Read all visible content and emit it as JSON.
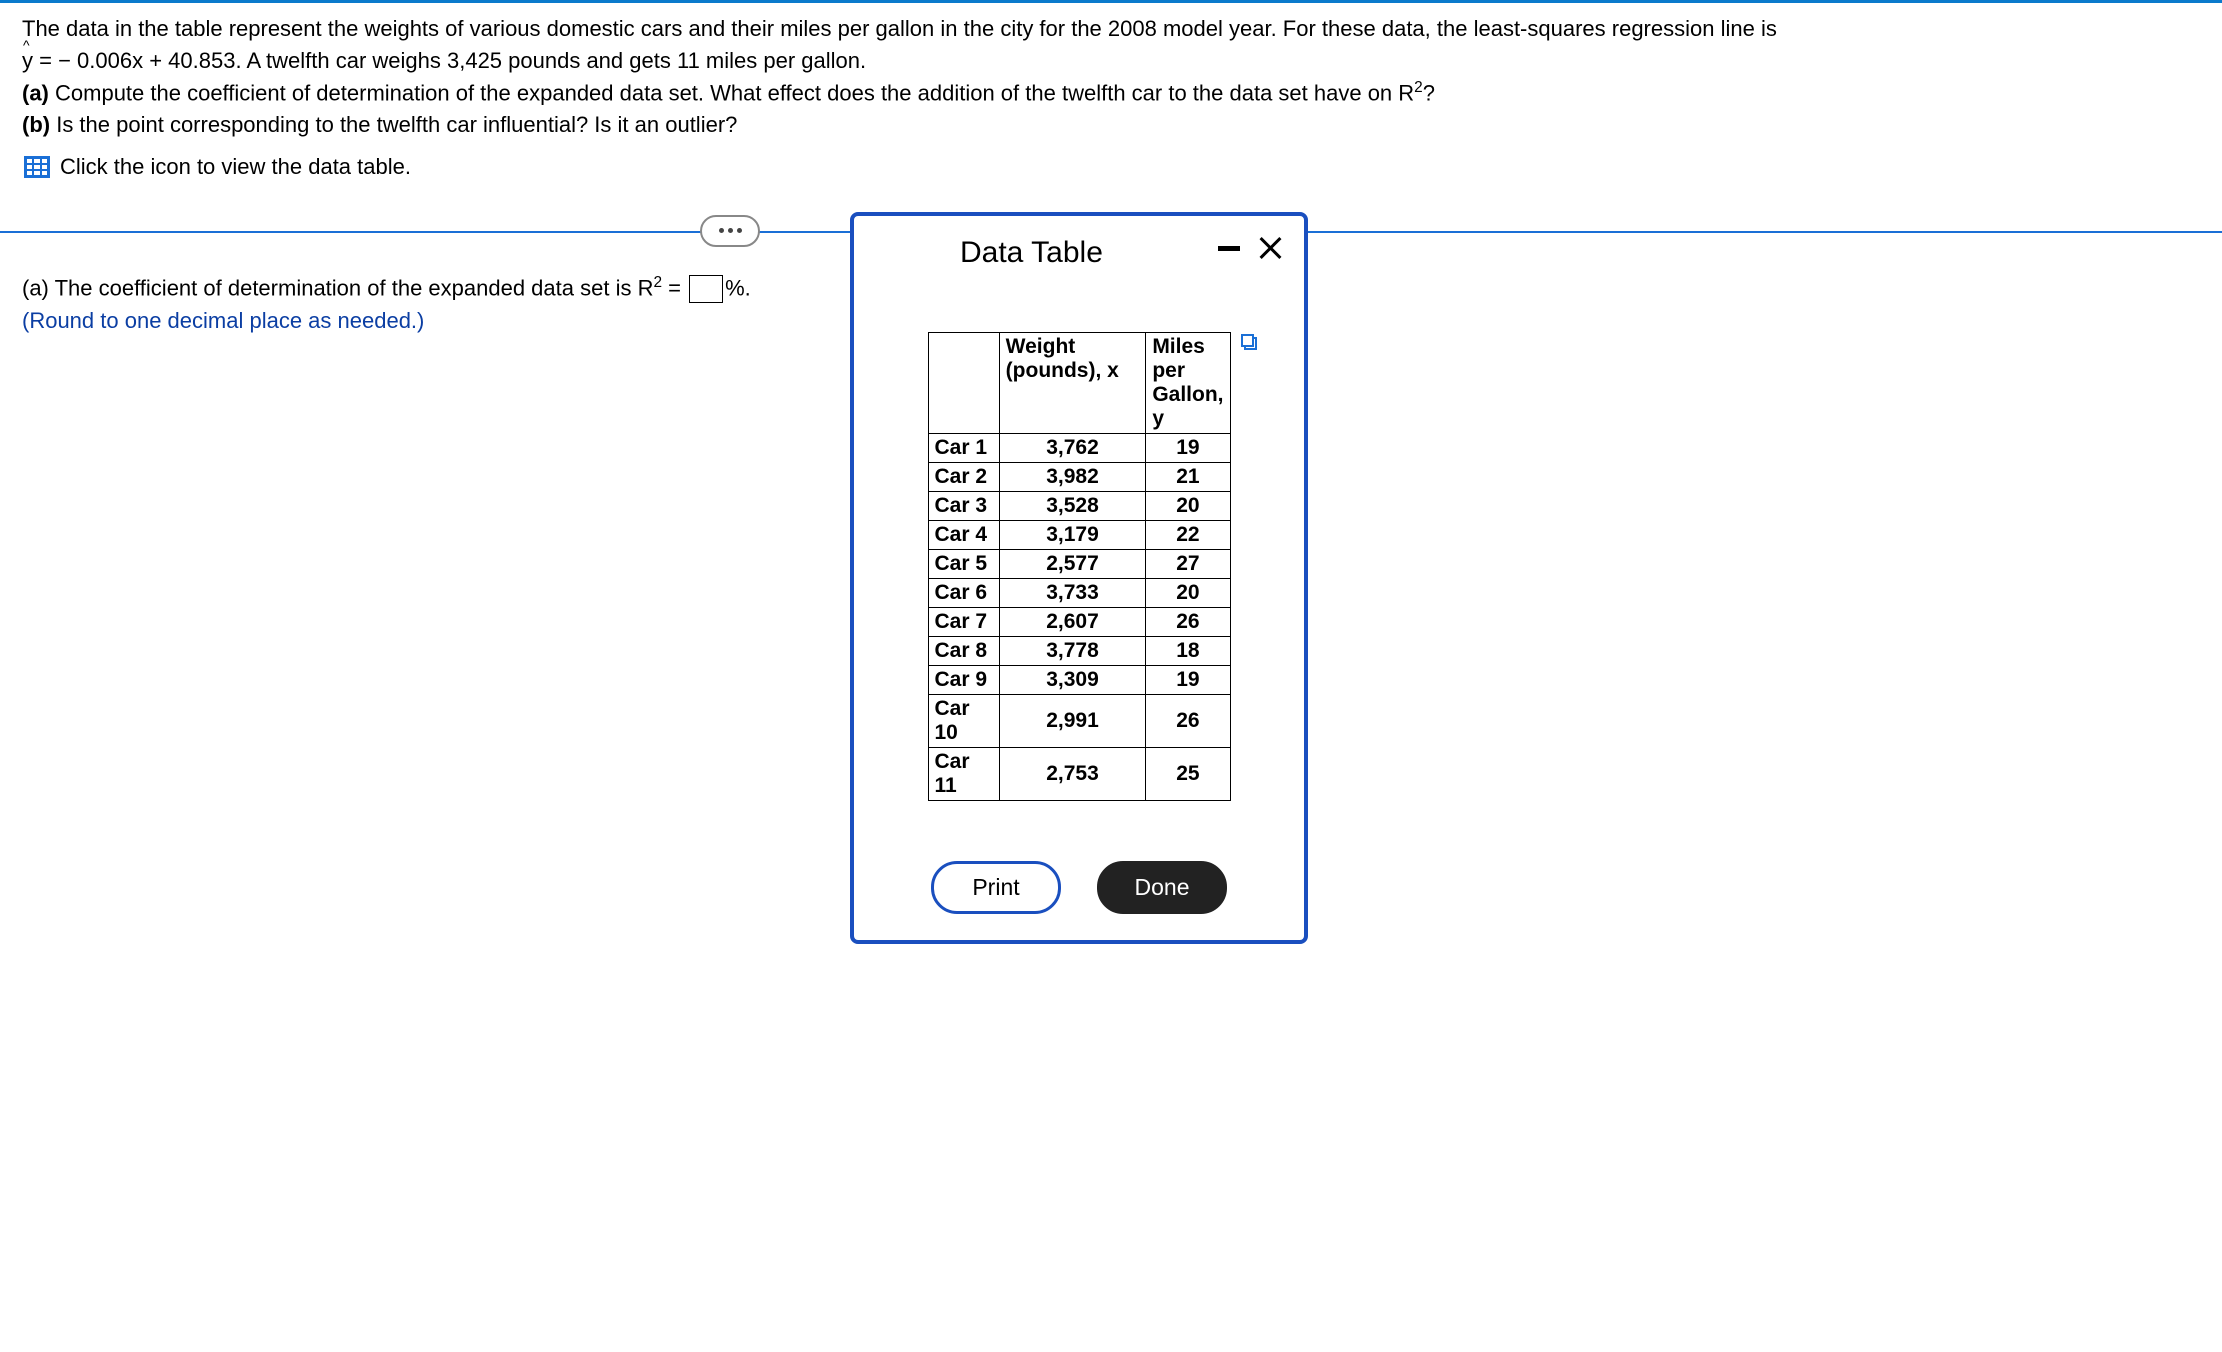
{
  "problem": {
    "intro": "The data in the table represent the weights of various domestic cars and their miles per gallon in the city for the 2008 model year. For these data, the least-squares regression line is",
    "equation_prefix": "y",
    "equation_rest": " = − 0.006x + 40.853. A twelfth car weighs 3,425 pounds and gets 11 miles per gallon.",
    "part_a_label": "(a)",
    "part_a_text": " Compute the coefficient of determination of the expanded data set. What effect does the addition of the twelfth car to the data set have on R",
    "part_a_suffix": "?",
    "part_b_label": "(b)",
    "part_b_text": " Is the point corresponding to the twelfth car influential? Is it an outlier?",
    "icon_text": "Click the icon to view the data table."
  },
  "answer": {
    "line1_pre": "(a) The coefficient of determination of the expanded data set is R",
    "line1_eq": " = ",
    "line1_post": "%.",
    "hint": "(Round to one decimal place as needed.)"
  },
  "modal": {
    "title": "Data Table",
    "headers": {
      "car": "",
      "weight": "Weight (pounds), x",
      "mpg": "Miles per Gallon, y"
    },
    "rows": [
      {
        "label": "Car 1",
        "weight": "3,762",
        "mpg": "19"
      },
      {
        "label": "Car 2",
        "weight": "3,982",
        "mpg": "21"
      },
      {
        "label": "Car 3",
        "weight": "3,528",
        "mpg": "20"
      },
      {
        "label": "Car 4",
        "weight": "3,179",
        "mpg": "22"
      },
      {
        "label": "Car 5",
        "weight": "2,577",
        "mpg": "27"
      },
      {
        "label": "Car 6",
        "weight": "3,733",
        "mpg": "20"
      },
      {
        "label": "Car 7",
        "weight": "2,607",
        "mpg": "26"
      },
      {
        "label": "Car 8",
        "weight": "3,778",
        "mpg": "18"
      },
      {
        "label": "Car 9",
        "weight": "3,309",
        "mpg": "19"
      },
      {
        "label": "Car 10",
        "weight": "2,991",
        "mpg": "26"
      },
      {
        "label": "Car 11",
        "weight": "2,753",
        "mpg": "25"
      }
    ],
    "buttons": {
      "print": "Print",
      "done": "Done"
    }
  },
  "chart_data": {
    "type": "table",
    "title": "Data Table",
    "columns": [
      "Car",
      "Weight (pounds), x",
      "Miles per Gallon, y"
    ],
    "data": [
      [
        "Car 1",
        3762,
        19
      ],
      [
        "Car 2",
        3982,
        21
      ],
      [
        "Car 3",
        3528,
        20
      ],
      [
        "Car 4",
        3179,
        22
      ],
      [
        "Car 5",
        2577,
        27
      ],
      [
        "Car 6",
        3733,
        20
      ],
      [
        "Car 7",
        2607,
        26
      ],
      [
        "Car 8",
        3778,
        18
      ],
      [
        "Car 9",
        3309,
        19
      ],
      [
        "Car 10",
        2991,
        26
      ],
      [
        "Car 11",
        2753,
        25
      ]
    ],
    "added_point": {
      "label": "Car 12",
      "weight": 3425,
      "mpg": 11
    },
    "regression_line": {
      "slope": -0.006,
      "intercept": 40.853
    }
  }
}
